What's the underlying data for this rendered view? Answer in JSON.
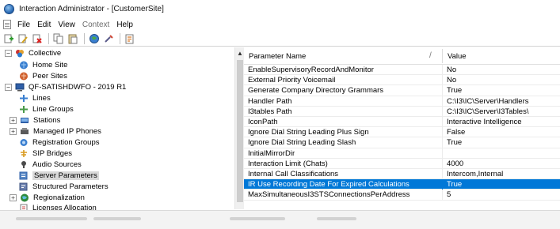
{
  "window": {
    "title": "Interaction Administrator - [CustomerSite]"
  },
  "menu": [
    {
      "label": "File",
      "enabled": true
    },
    {
      "label": "Edit",
      "enabled": true
    },
    {
      "label": "View",
      "enabled": true
    },
    {
      "label": "Context",
      "enabled": false
    },
    {
      "label": "Help",
      "enabled": true
    }
  ],
  "toolbar": {
    "icons": [
      "new-icon",
      "edit-icon",
      "delete-icon",
      "copy-icon",
      "paste-icon",
      "globe-icon",
      "tools-icon",
      "properties-icon"
    ]
  },
  "tree": [
    {
      "label": "Collective",
      "icon": "collective-icon",
      "expander": "⊟"
    },
    {
      "label": "Home Site",
      "icon": "home-site-icon"
    },
    {
      "label": "Peer Sites",
      "icon": "peer-sites-icon"
    },
    {
      "label": "QF-SATISHDWFO - 2019 R1",
      "icon": "server-icon",
      "expander": "⊟"
    },
    {
      "label": "Lines",
      "icon": "lines-icon"
    },
    {
      "label": "Line Groups",
      "icon": "line-groups-icon"
    },
    {
      "label": "Stations",
      "icon": "stations-icon",
      "expander": "⊞"
    },
    {
      "label": "Managed IP Phones",
      "icon": "phones-icon",
      "expander": "⊞"
    },
    {
      "label": "Registration Groups",
      "icon": "registration-groups-icon"
    },
    {
      "label": "SIP Bridges",
      "icon": "sip-bridges-icon"
    },
    {
      "label": "Audio Sources",
      "icon": "audio-sources-icon"
    },
    {
      "label": "Server Parameters",
      "icon": "server-parameters-icon",
      "selected": true
    },
    {
      "label": "Structured Parameters",
      "icon": "structured-parameters-icon"
    },
    {
      "label": "Regionalization",
      "icon": "regionalization-icon",
      "expander": "⊞"
    },
    {
      "label": "Licenses Allocation",
      "icon": "licenses-icon"
    }
  ],
  "grid": {
    "columns": [
      "Parameter Name",
      "Value"
    ],
    "rows": [
      [
        "EnableSupervisoryRecordAndMonitor",
        "No"
      ],
      [
        "External Priority Voicemail",
        "No"
      ],
      [
        "Generate Company Directory Grammars",
        "True"
      ],
      [
        "Handler Path",
        "C:\\I3\\IC\\Server\\Handlers"
      ],
      [
        "I3tables Path",
        "C:\\I3\\IC\\Server\\I3Tables\\"
      ],
      [
        "IconPath",
        "Interactive Intelligence"
      ],
      [
        "Ignore Dial String Leading Plus Sign",
        "False"
      ],
      [
        "Ignore Dial String Leading Slash",
        "True"
      ],
      [
        "InitialMirrorDir",
        ""
      ],
      [
        "Interaction Limit (Chats)",
        "4000"
      ],
      [
        "Internal Call Classifications",
        "Intercom,Internal"
      ],
      [
        "IR Use Recording Date For Expired Calculations",
        "True"
      ],
      [
        "MaxSimultaneousI3STSConnectionsPerAddress",
        "5"
      ]
    ],
    "selected_row": 11
  },
  "colors": {
    "selection": "#0078d7",
    "tree_selection": "#d9d9d9"
  }
}
